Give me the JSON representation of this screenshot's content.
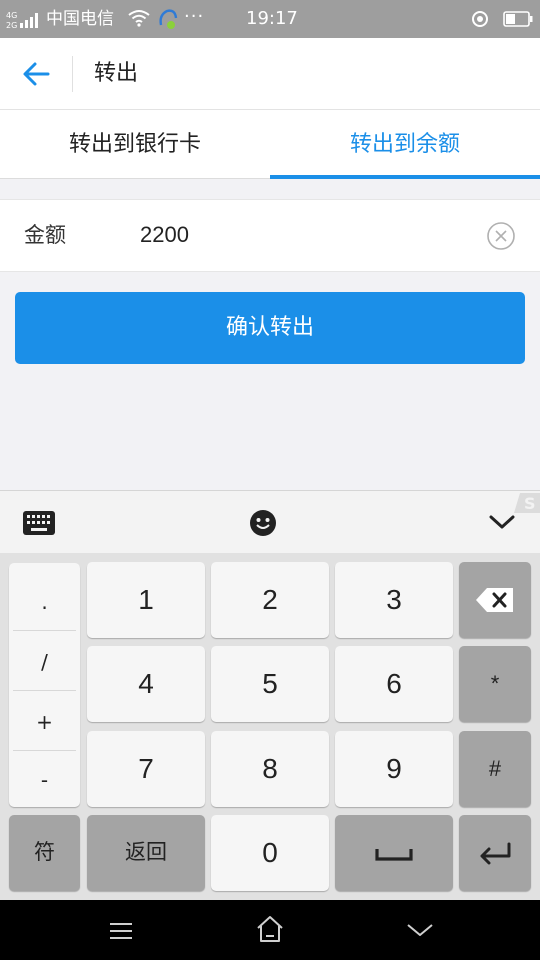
{
  "status_bar": {
    "carrier": "中国电信",
    "time": "19:17",
    "dots": "···",
    "icons": [
      "signal-icon",
      "wifi-icon",
      "app-notification-icon",
      "location-icon",
      "battery-icon"
    ]
  },
  "header": {
    "title": "转出",
    "back_icon": "back-arrow-icon"
  },
  "tabs": [
    {
      "label": "转出到银行卡",
      "active": false
    },
    {
      "label": "转出到余额",
      "active": true
    }
  ],
  "form": {
    "amount_label": "金额",
    "amount_value": "2200",
    "clear_icon": "clear-icon"
  },
  "confirm_button": "确认转出",
  "keyboard": {
    "toolbar_icons": [
      "keyboard-icon",
      "emoji-icon",
      "collapse-icon"
    ],
    "symbols": [
      ".",
      "/",
      "+",
      "-"
    ],
    "digits": [
      "1",
      "2",
      "3",
      "4",
      "5",
      "6",
      "7",
      "8",
      "9",
      "0"
    ],
    "star": "*",
    "hash": "#",
    "symbol_switch": "符",
    "return_label": "返回"
  },
  "nav_bar": {
    "icons": [
      "menu-icon",
      "home-icon",
      "back-chevron-icon"
    ]
  },
  "colors": {
    "accent": "#1b8fe8",
    "status_bar": "#9e9e9e",
    "nav_bar": "#000000"
  }
}
